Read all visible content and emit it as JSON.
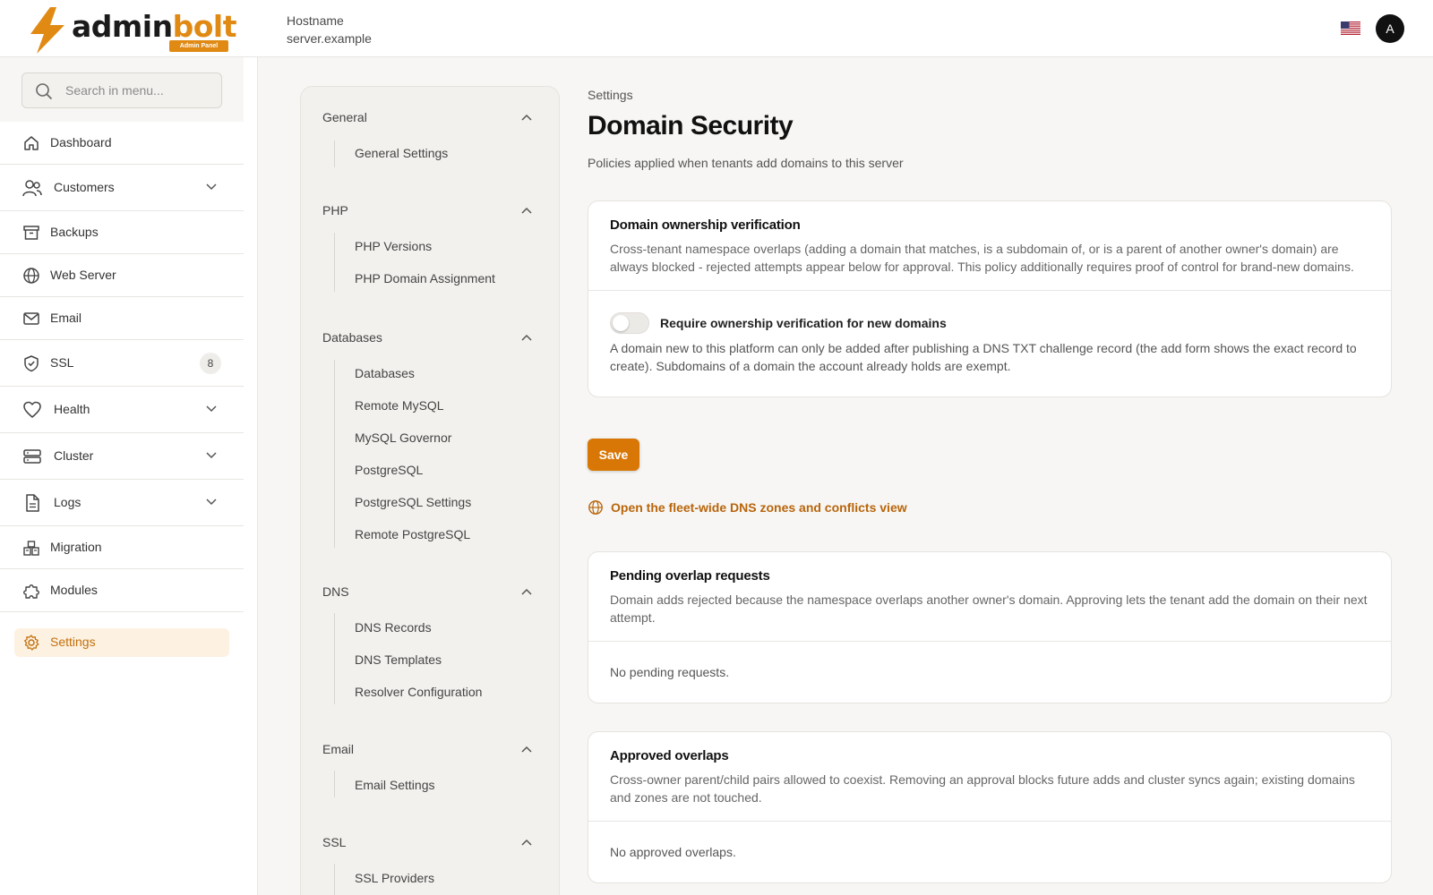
{
  "brand": {
    "name_part1": "admin",
    "name_part2": "bolt",
    "badge": "Admin Panel",
    "accent_color": "#e08a14"
  },
  "header": {
    "hostname_label": "Hostname",
    "hostname_value": "server.example",
    "locale_icon": "us-flag-icon",
    "avatar_initial": "A"
  },
  "sidebar": {
    "search_placeholder": "Search in menu...",
    "items": [
      {
        "label": "Dashboard",
        "icon": "home-icon"
      },
      {
        "label": "Customers",
        "icon": "users-icon",
        "expandable": true
      },
      {
        "label": "Backups",
        "icon": "archive-icon"
      },
      {
        "label": "Web Server",
        "icon": "globe-icon"
      },
      {
        "label": "Email",
        "icon": "mail-icon"
      },
      {
        "label": "SSL",
        "icon": "shield-icon",
        "badge": "8"
      },
      {
        "label": "Health",
        "icon": "heart-icon",
        "expandable": true
      },
      {
        "label": "Cluster",
        "icon": "server-icon",
        "expandable": true
      },
      {
        "label": "Logs",
        "icon": "file-icon",
        "expandable": true
      },
      {
        "label": "Migration",
        "icon": "migration-icon"
      },
      {
        "label": "Modules",
        "icon": "puzzle-icon"
      },
      {
        "label": "Settings",
        "icon": "gear-icon",
        "active": true
      }
    ]
  },
  "subnav": {
    "sections": [
      {
        "title": "General",
        "links": [
          "General Settings"
        ]
      },
      {
        "title": "PHP",
        "links": [
          "PHP Versions",
          "PHP Domain Assignment"
        ]
      },
      {
        "title": "Databases",
        "links": [
          "Databases",
          "Remote MySQL",
          "MySQL Governor",
          "PostgreSQL",
          "PostgreSQL Settings",
          "Remote PostgreSQL"
        ]
      },
      {
        "title": "DNS",
        "links": [
          "DNS Records",
          "DNS Templates",
          "Resolver Configuration"
        ]
      },
      {
        "title": "Email",
        "links": [
          "Email Settings"
        ]
      },
      {
        "title": "SSL",
        "links": [
          "SSL Providers"
        ]
      }
    ]
  },
  "main": {
    "breadcrumb": "Settings",
    "title": "Domain Security",
    "subtitle": "Policies applied when tenants add domains to this server",
    "verification_card": {
      "title": "Domain ownership verification",
      "description": "Cross-tenant namespace overlaps (adding a domain that matches, is a subdomain of, or is a parent of another owner's domain) are always blocked - rejected attempts appear below for approval. This policy additionally requires proof of control for brand-new domains.",
      "toggle_label": "Require ownership verification for new domains",
      "toggle_on": false,
      "toggle_help": "A domain new to this platform can only be added after publishing a DNS TXT challenge record (the add form shows the exact record to create). Subdomains of a domain the account already holds are exempt."
    },
    "save_label": "Save",
    "fleet_link": "Open the fleet-wide DNS zones and conflicts view",
    "pending_card": {
      "title": "Pending overlap requests",
      "description": "Domain adds rejected because the namespace overlaps another owner's domain. Approving lets the tenant add the domain on their next attempt.",
      "empty": "No pending requests."
    },
    "approved_card": {
      "title": "Approved overlaps",
      "description": "Cross-owner parent/child pairs allowed to coexist. Removing an approval blocks future adds and cluster syncs again; existing domains and zones are not touched.",
      "empty": "No approved overlaps."
    }
  }
}
